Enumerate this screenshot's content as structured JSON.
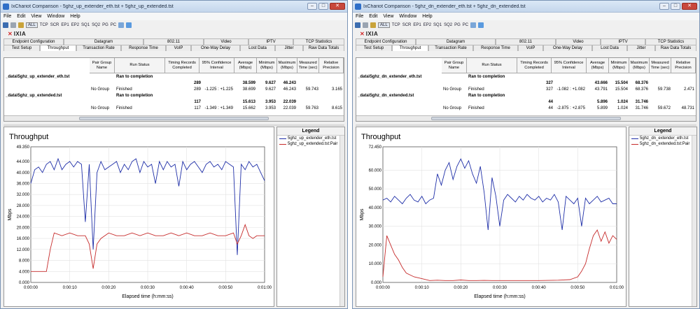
{
  "windows": [
    {
      "title": "IxChariot Comparison - 5ghz_up_extender_eth.tst + 5ghz_up_extended.tst",
      "rows": [
        {
          "file": "_data\\5ghz_up_extender_eth.tst",
          "status_bold": "Ran to completion",
          "timing": "289",
          "avg": "38.599",
          "min": "9.627",
          "max": "46.243",
          "group": "No Group",
          "status": "Finished",
          "timing2": "289",
          "conf": "-1.225 : +1.225",
          "avg2": "38.699",
          "min2": "9.627",
          "max2": "46.243",
          "measured": "59.743",
          "precision": "3.165"
        },
        {
          "file": "_data\\5ghz_up_extended.tst",
          "status_bold": "Ran to completion",
          "timing": "117",
          "avg": "15.613",
          "min": "3.953",
          "max": "22.039",
          "group": "No Group",
          "status": "Finished",
          "timing2": "117",
          "conf": "-1.349 : +1.349",
          "avg2": "15.662",
          "min2": "3.953",
          "max2": "22.039",
          "measured": "59.763",
          "precision": "8.615"
        }
      ],
      "legend": [
        "5ghz_up_extender_eth.tst",
        "5ghz_up_extended.tst:Pair"
      ]
    },
    {
      "title": "IxChariot Comparison - 5ghz_dn_extender_eth.tst + 5ghz_dn_extended.tst",
      "rows": [
        {
          "file": "_data\\5ghz_dn_extender_eth.tst",
          "status_bold": "Ran to completion",
          "timing": "327",
          "avg": "43.666",
          "min": "15.504",
          "max": "68.376",
          "group": "No Group",
          "status": "Finished",
          "timing2": "327",
          "conf": "-1.082 : +1.082",
          "avg2": "43.791",
          "min2": "15.504",
          "max2": "68.376",
          "measured": "59.738",
          "precision": "2.471"
        },
        {
          "file": "_data\\5ghz_dn_extended.tst",
          "status_bold": "Ran to completion",
          "timing": "44",
          "avg": "5.896",
          "min": "1.024",
          "max": "31.746",
          "group": "No Group",
          "status": "Finished",
          "timing2": "44",
          "conf": "-2.875 : +2.875",
          "avg2": "5.899",
          "min2": "1.024",
          "max2": "31.746",
          "measured": "59.672",
          "precision": "48.731"
        }
      ],
      "legend": [
        "5ghz_dn_extender_eth.tst",
        "5ghz_dn_extended.tst:Pair"
      ]
    }
  ],
  "menu": [
    "File",
    "Edit",
    "View",
    "Window",
    "Help"
  ],
  "toolbar_items": [
    "ALL",
    "TCP",
    "SCR",
    "EP1",
    "EP2",
    "SQ1",
    "SQ2",
    "PG",
    "PC"
  ],
  "logo": "IXIA",
  "tabs_top": [
    "Endpoint Configuration",
    "Datagram",
    "802.11",
    "Video",
    "IPTV",
    "TCP Statistics"
  ],
  "tabs_bottom": [
    "Test Setup",
    "Throughput",
    "Transaction Rate",
    "Response Time",
    "VoIP",
    "One-Way Delay",
    "Lost Data",
    "Jitter",
    "Raw Data Totals"
  ],
  "headers": [
    "Pair Group Name",
    "Run Status",
    "Timing Records Completed",
    "95% Confidence Interval",
    "Average (Mbps)",
    "Minimum (Mbps)",
    "Maximum (Mbps)",
    "Measured Time (sec)",
    "Relative Precision"
  ],
  "legend_title": "Legend",
  "chart": {
    "title": "Throughput",
    "ylabel": "Mbps",
    "xlabel": "Elapsed time (h:mm:ss)"
  },
  "colors": {
    "series1": "#1f2fa8",
    "series2": "#c62b2b"
  },
  "chart_data": [
    {
      "type": "line",
      "title": "Throughput",
      "xlabel": "Elapsed time (h:mm:ss)",
      "ylabel": "Mbps",
      "ylim": [
        0,
        49.35
      ],
      "yticks": [
        "0.000",
        "4.000",
        "8.000",
        "12.000",
        "16.000",
        "20.000",
        "24.000",
        "28.000",
        "32.000",
        "36.000",
        "40.000",
        "44.000",
        "49.350"
      ],
      "xticks": [
        "0:00:00",
        "0:00:10",
        "0:00:20",
        "0:00:30",
        "0:00:40",
        "0:00:50",
        "0:01:00"
      ],
      "series": [
        {
          "name": "5ghz_up_extender_eth.tst",
          "x": [
            0,
            1,
            2,
            3,
            4,
            5,
            6,
            7,
            8,
            9,
            10,
            11,
            12,
            13,
            14,
            15,
            16,
            17,
            18,
            19,
            20,
            21,
            22,
            23,
            24,
            25,
            26,
            27,
            28,
            29,
            30,
            31,
            32,
            33,
            34,
            35,
            36,
            37,
            38,
            39,
            40,
            41,
            42,
            43,
            44,
            45,
            46,
            47,
            48,
            49,
            50,
            51,
            52,
            53,
            54,
            55,
            56,
            57,
            58,
            59,
            60
          ],
          "values": [
            36,
            41,
            42,
            40,
            43,
            44,
            41,
            45,
            41,
            43,
            44,
            42,
            44,
            43,
            22,
            43,
            12,
            40,
            44,
            41,
            42,
            43,
            44,
            40,
            43,
            41,
            44,
            45,
            40,
            44,
            42,
            43,
            36,
            44,
            41,
            44,
            42,
            43,
            35,
            44,
            41,
            43,
            44,
            42,
            40,
            43,
            44,
            42,
            43,
            41,
            44,
            43,
            42,
            10,
            43,
            41,
            44,
            42,
            43,
            40,
            37
          ]
        },
        {
          "name": "5ghz_up_extended.tst:Pair",
          "x": [
            0,
            2,
            4,
            5,
            6,
            8,
            10,
            12,
            14,
            15,
            16,
            17,
            18,
            20,
            22,
            24,
            26,
            28,
            30,
            32,
            34,
            36,
            38,
            40,
            42,
            44,
            46,
            48,
            50,
            52,
            53,
            54,
            55,
            56,
            57,
            58,
            60
          ],
          "values": [
            4,
            4,
            4,
            12,
            18,
            17,
            18,
            17,
            17,
            14,
            5,
            14,
            16,
            18,
            17,
            17,
            18,
            17,
            18,
            17,
            17,
            18,
            17,
            18,
            17,
            17,
            18,
            17,
            17,
            18,
            14,
            17,
            21,
            17,
            16,
            17,
            17
          ]
        }
      ]
    },
    {
      "type": "line",
      "title": "Throughput",
      "xlabel": "Elapsed time (h:mm:ss)",
      "ylabel": "Mbps",
      "ylim": [
        0,
        72.45
      ],
      "yticks": [
        "0.000",
        "10.000",
        "20.000",
        "30.000",
        "40.000",
        "50.000",
        "60.000",
        "72.450"
      ],
      "xticks": [
        "0:00:00",
        "0:00:10",
        "0:00:20",
        "0:00:30",
        "0:00:40",
        "0:00:50",
        "0:01:00"
      ],
      "series": [
        {
          "name": "5ghz_dn_extender_eth.tst",
          "x": [
            0,
            1,
            2,
            3,
            4,
            5,
            6,
            7,
            8,
            9,
            10,
            11,
            12,
            13,
            14,
            15,
            16,
            17,
            18,
            19,
            20,
            21,
            22,
            23,
            24,
            25,
            26,
            27,
            28,
            29,
            30,
            31,
            32,
            33,
            34,
            35,
            36,
            37,
            38,
            39,
            40,
            41,
            42,
            43,
            44,
            45,
            46,
            47,
            48,
            49,
            50,
            51,
            52,
            53,
            54,
            55,
            56,
            57,
            58,
            59,
            60
          ],
          "values": [
            44,
            45,
            43,
            46,
            44,
            42,
            45,
            47,
            44,
            43,
            46,
            42,
            44,
            45,
            58,
            52,
            60,
            64,
            55,
            62,
            66,
            61,
            65,
            58,
            53,
            62,
            48,
            28,
            56,
            46,
            30,
            44,
            47,
            45,
            43,
            46,
            44,
            47,
            45,
            44,
            46,
            43,
            45,
            44,
            47,
            43,
            28,
            46,
            44,
            42,
            45,
            30,
            45,
            42,
            44,
            46,
            43,
            44,
            45,
            42,
            42
          ]
        },
        {
          "name": "5ghz_dn_extended.tst:Pair",
          "x": [
            0,
            1,
            2,
            3,
            4,
            5,
            6,
            8,
            10,
            12,
            14,
            16,
            18,
            20,
            22,
            24,
            26,
            28,
            30,
            35,
            40,
            45,
            48,
            50,
            51,
            52,
            53,
            54,
            55,
            56,
            57,
            58,
            59,
            60
          ],
          "values": [
            3,
            25,
            20,
            15,
            12,
            8,
            5,
            3,
            2,
            1,
            1.2,
            1,
            1,
            1.3,
            1,
            1,
            1.1,
            1,
            1,
            1,
            1,
            1.2,
            1.5,
            3,
            6,
            10,
            18,
            25,
            28,
            22,
            27,
            21,
            25,
            23
          ]
        }
      ]
    }
  ]
}
